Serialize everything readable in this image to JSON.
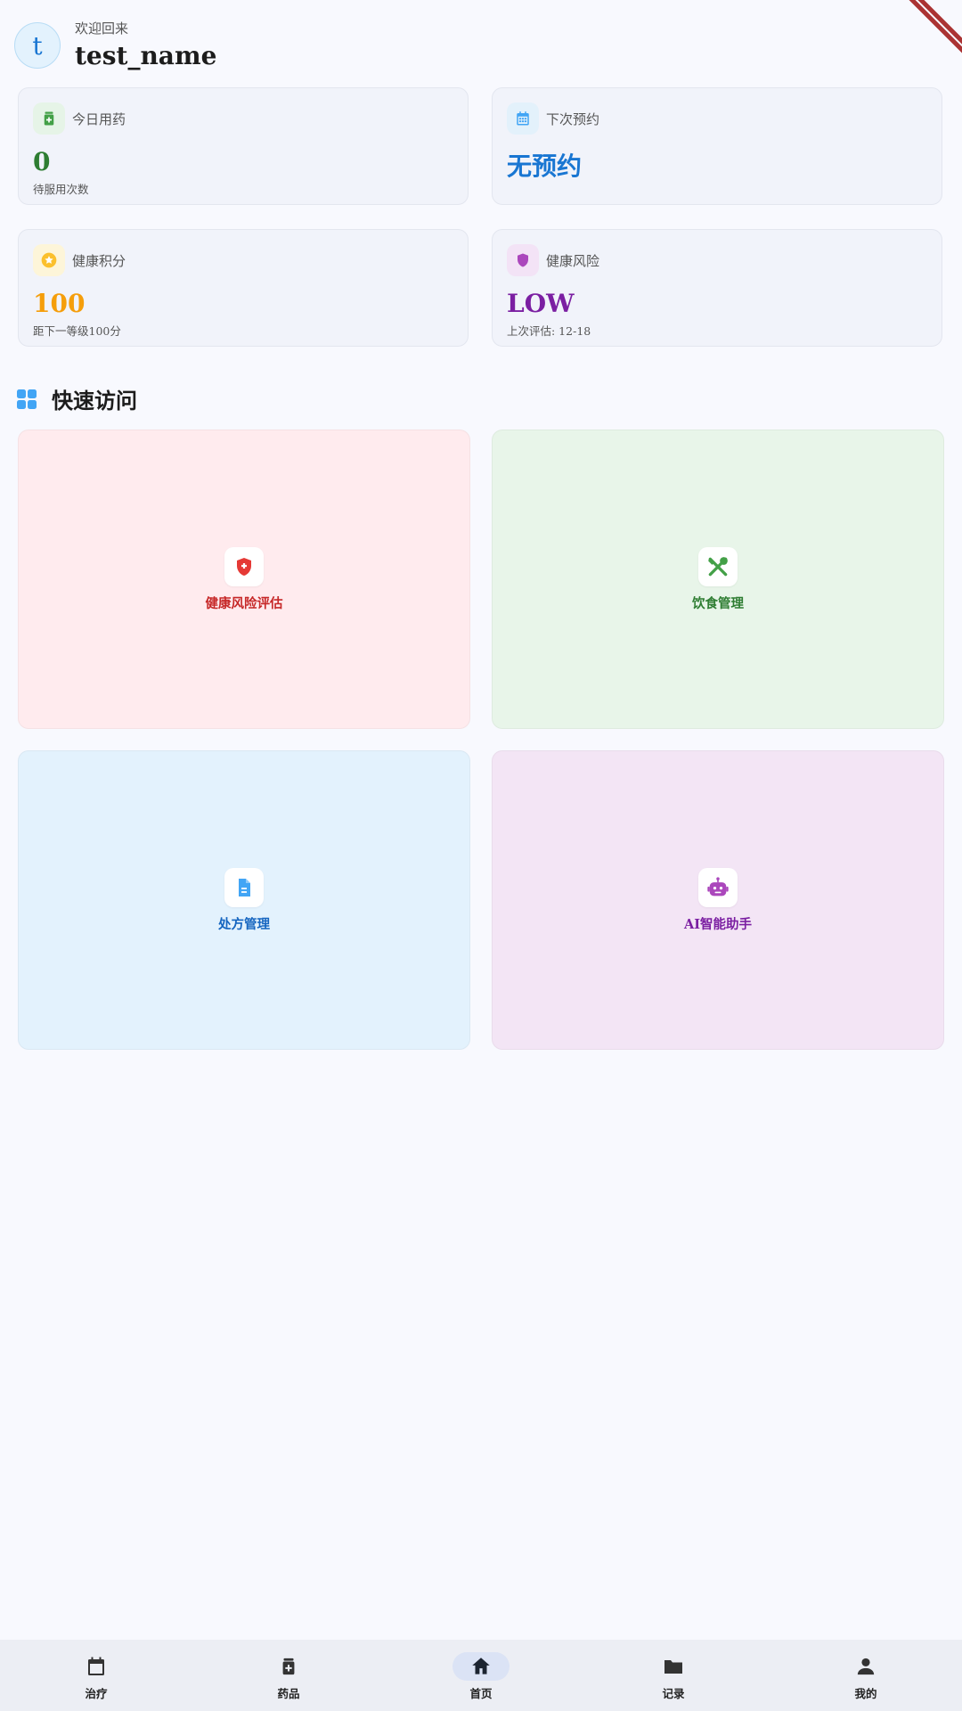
{
  "header": {
    "avatar_letter": "t",
    "welcome": "欢迎回来",
    "username": "test_name"
  },
  "stats": [
    {
      "label": "今日用药",
      "value": "0",
      "sub": "待服用次数",
      "icon": "medication-icon",
      "color": "#2e7d32",
      "icon_bg": "#e6f4e7"
    },
    {
      "label": "下次预约",
      "value": "无预约",
      "sub": "",
      "icon": "calendar-icon",
      "color": "#1976d2",
      "icon_bg": "#e3f1fb"
    },
    {
      "label": "健康积分",
      "value": "100",
      "sub": "距下一等级100分",
      "icon": "star-icon",
      "color": "#f59e0b",
      "icon_bg": "#fdf5d9"
    },
    {
      "label": "健康风险",
      "value": "LOW",
      "sub": "上次评估: 12-18",
      "icon": "shield-icon",
      "color": "#7b1fa2",
      "icon_bg": "#f3e3f6"
    }
  ],
  "quick_access": {
    "title": "快速访问",
    "tiles": [
      {
        "label": "健康风险评估",
        "icon": "health-shield-icon",
        "bg": "#ffebee",
        "color": "#c62828"
      },
      {
        "label": "饮食管理",
        "icon": "utensils-icon",
        "bg": "#e8f5e9",
        "color": "#2e7d32"
      },
      {
        "label": "处方管理",
        "icon": "prescription-doc-icon",
        "bg": "#e3f2fd",
        "color": "#1565c0"
      },
      {
        "label": "AI智能助手",
        "icon": "robot-icon",
        "bg": "#f3e5f5",
        "color": "#7b1fa2"
      }
    ]
  },
  "bottom_nav": {
    "active": "首页",
    "items": [
      {
        "label": "治疗",
        "icon": "calendar-icon"
      },
      {
        "label": "药品",
        "icon": "medicine-icon"
      },
      {
        "label": "首页",
        "icon": "home-icon"
      },
      {
        "label": "记录",
        "icon": "folder-icon"
      },
      {
        "label": "我的",
        "icon": "person-icon"
      }
    ]
  }
}
